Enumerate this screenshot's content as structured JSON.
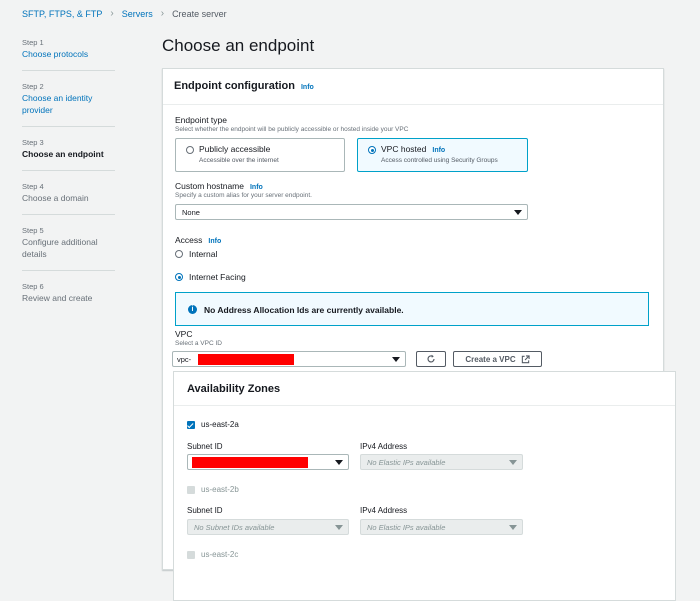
{
  "breadcrumb": {
    "items": [
      "SFTP, FTPS, & FTP",
      "Servers"
    ],
    "current": "Create server"
  },
  "steps": [
    {
      "num": "Step 1",
      "label": "Choose protocols",
      "state": "link"
    },
    {
      "num": "Step 2",
      "label": "Choose an identity provider",
      "state": "link"
    },
    {
      "num": "Step 3",
      "label": "Choose an endpoint",
      "state": "active"
    },
    {
      "num": "Step 4",
      "label": "Choose a domain",
      "state": "disabled"
    },
    {
      "num": "Step 5",
      "label": "Configure additional details",
      "state": "disabled"
    },
    {
      "num": "Step 6",
      "label": "Review and create",
      "state": "disabled"
    }
  ],
  "page_title": "Choose an endpoint",
  "config": {
    "title": "Endpoint configuration",
    "info": "Info",
    "endpoint_type": {
      "label": "Endpoint type",
      "description": "Select whether the endpoint will be publicly accessible or hosted inside your VPC",
      "options": [
        {
          "title": "Publicly accessible",
          "info": "",
          "desc": "Accessible over the internet",
          "selected": false
        },
        {
          "title": "VPC hosted",
          "info": "Info",
          "desc": "Access controlled using Security Groups",
          "selected": true
        }
      ]
    },
    "hostname": {
      "label": "Custom hostname",
      "info": "Info",
      "description": "Specify a custom alias for your server endpoint.",
      "value": "None"
    },
    "access": {
      "label": "Access",
      "info": "Info",
      "options": [
        {
          "label": "Internal",
          "selected": false
        },
        {
          "label": "Internet Facing",
          "selected": true
        }
      ]
    },
    "alert": {
      "icon": "info-circle-icon",
      "text": "No Address Allocation Ids are currently available."
    },
    "vpc": {
      "label": "VPC",
      "description": "Select a VPC ID",
      "value_prefix": "vpc-",
      "refresh_icon": "refresh-icon",
      "create_label": "Create a VPC",
      "create_icon": "external-link-icon"
    },
    "az": {
      "title": "Availability Zones",
      "zones": [
        {
          "name": "us-east-2a",
          "checked": true,
          "subnet_label": "Subnet ID",
          "subnet_value": "",
          "subnet_disabled": false,
          "ipv4_label": "IPv4 Address",
          "ipv4_value": "No Elastic IPs available"
        },
        {
          "name": "us-east-2b",
          "checked": false,
          "subnet_label": "Subnet ID",
          "subnet_value": "No Subnet IDs available",
          "subnet_disabled": true,
          "ipv4_label": "IPv4 Address",
          "ipv4_value": "No Elastic IPs available"
        },
        {
          "name": "us-east-2c",
          "checked": false
        }
      ]
    }
  },
  "colors": {
    "link": "#0073bb",
    "selected_border": "#00a1c9",
    "selected_bg": "#f1faff",
    "redaction": "#ff0000"
  }
}
